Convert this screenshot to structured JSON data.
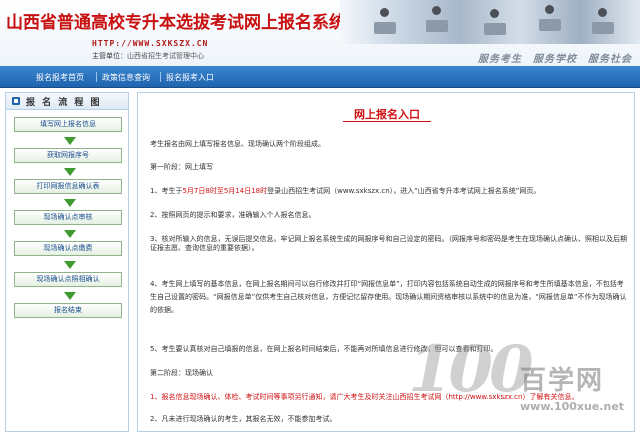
{
  "header": {
    "title": "山西省普通高校专升本选拔考试网上报名系统",
    "url": "HTTP://WWW.SXKSZX.CN",
    "host_label": "主管单位：",
    "host_value": "山西省招生考试管理中心",
    "slogan": "服务考生　服务学校　服务社会"
  },
  "nav": {
    "items": [
      "报名报考首页",
      "政策信息查询",
      "报名报考入口"
    ]
  },
  "sidebar": {
    "heading": "报 名 流 程 图",
    "steps": [
      "填写网上报名信息",
      "获取网报序号",
      "打印网报信息确认表",
      "现场确认点审核",
      "现场确认点缴费",
      "现场确认点照相确认",
      "报名结束"
    ]
  },
  "main": {
    "title": "网上报名入口",
    "intro": "考生报名由网上填写报名信息、现场确认两个阶段组成。",
    "stage1": "第一阶段：网上填写",
    "item1_a": "1、考生于",
    "item1_date": "5月7日8时至5月14日18时",
    "item1_b": "登录山西招生考试网（www.sxkszx.cn），进入“山西省专升本考试网上报名系统”网页。",
    "item2": "2、按照网页的提示和要求，准确输入个人报名信息。",
    "item3": "3、核对所输入的信息，无误后提交信息。牢记网上报名系统生成的网报序号和自己设定的密码。（网报序号和密码是考生在现场确认点确认、照相以及后期证报志愿、查询信息的重要依据）。",
    "item4": "4、考生网上填写的基本信息，在网上报名期间可以自行修改并打印“网报信息单”，打印内容包括系统自动生成的网报序号和考生所填基本信息，不包括考生自己设置的密码。“网报信息单”仅供考生自己核对信息，方便记忆留存使用。现场确认期间资格审核以系统中的信息为准，“网报信息单”不作为现场确认的依据。",
    "item5": "5、考生要认真核对自己填报的信息，在网上报名时间结束后，不能再对所填信息进行修改，但可以查看和打印。",
    "stage2": "第二阶段：现场确认",
    "item2_1_a": "1、报名信息现场确认、体检、考试时间等事项另行通知，请广大考生及时关注山西招生考试网",
    "item2_1_url": "（http://www.sxkszx.cn）",
    "item2_1_b": "了解有关信息。",
    "item2_2": "2、凡未进行现场确认的考生，其报名无效，不能参加考试。"
  },
  "watermark": {
    "digits": "100",
    "name": "百学网",
    "url": "www.100xue.net"
  },
  "colors": {
    "title_red": "#c81010",
    "nav_blue": "#1f63ad",
    "step_arrow": "#3f9a2f"
  }
}
